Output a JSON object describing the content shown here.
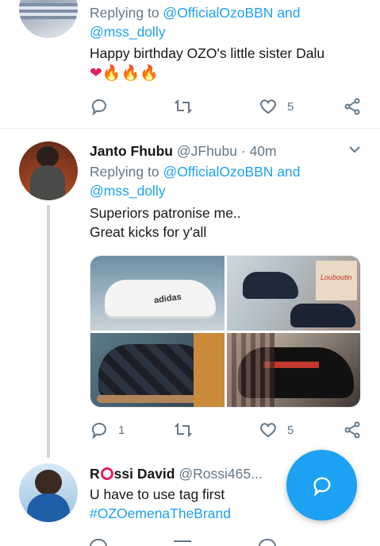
{
  "colors": {
    "accent": "#1da1f2",
    "muted": "#657786",
    "divider": "#e6ecf0"
  },
  "tweet1": {
    "replying_to": "Replying to",
    "handle1": "@OfficialOzoBBN",
    "and": "and",
    "handle2": "@mss_dolly",
    "body": "Happy birthday OZO's little sister Dalu",
    "emoji": "❤🔥🔥🔥",
    "likes": "5"
  },
  "tweet2": {
    "name": "Janto Fhubu",
    "handle": "@JFhubu",
    "sep": "·",
    "time": "40m",
    "replying_to": "Replying to",
    "handle1": "@OfficialOzoBBN",
    "and": "and",
    "handle2": "@mss_dolly",
    "line1": "Superiors patronise me..",
    "line2": "Great kicks for y'all",
    "media": [
      "sneaker-image",
      "dark-sneaker-image",
      "monogram-shoe-image",
      "loafer-image"
    ],
    "media_text": {
      "adidas": "adidas",
      "louboutin": "Louboutin"
    },
    "replies": "1",
    "likes": "5"
  },
  "tweet3": {
    "name_prefix": "R",
    "name_suffix": "ssi David",
    "handle": "@Rossi465...",
    "line1": "U have to use tag first",
    "hashtag": "#OZOemenaTheBrand"
  },
  "fab": {
    "icon": "compose-reply-icon"
  }
}
